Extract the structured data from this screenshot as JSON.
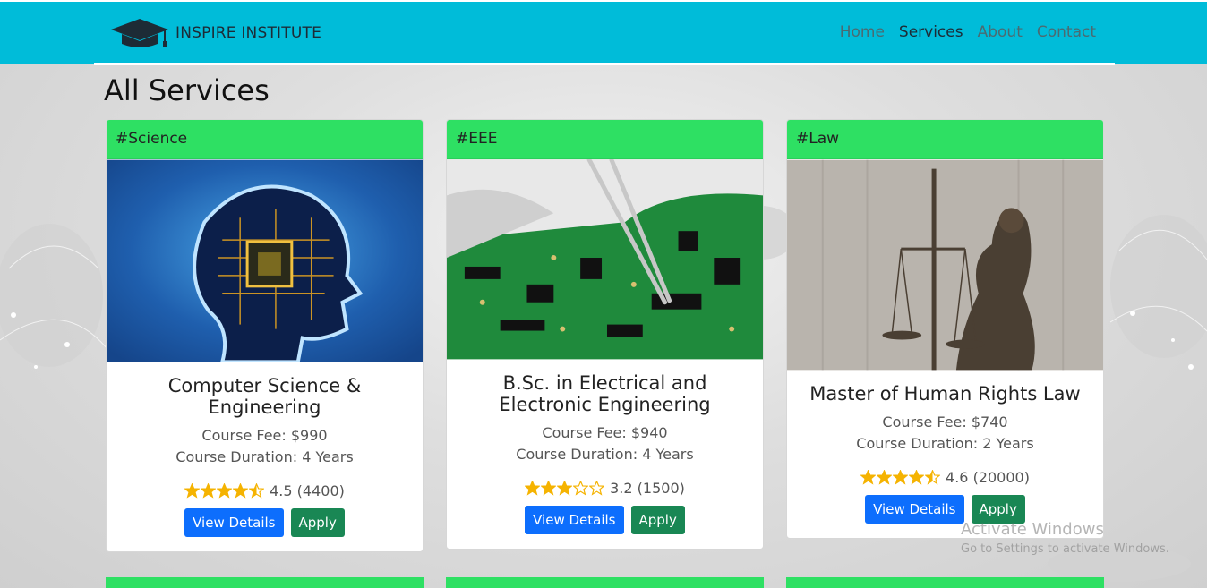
{
  "brand": {
    "name": "INSPIRE INSTITUTE",
    "icon": "graduation-cap-icon"
  },
  "nav": {
    "items": [
      "Home",
      "Services",
      "About",
      "Contact"
    ],
    "active": "Services"
  },
  "page": {
    "title": "All Services"
  },
  "cards": [
    {
      "tag": "#Science",
      "title": "Computer Science & Engineering",
      "fee": "Course Fee: $990",
      "duration": "Course Duration: 4 Years",
      "rating": 4.5,
      "rating_text": "4.5 (4400)",
      "view_label": "View Details",
      "apply_label": "Apply",
      "image": "ai-brain-chip-image"
    },
    {
      "tag": "#EEE",
      "title": "B.Sc. in Electrical and Electronic Engineering",
      "fee": "Course Fee: $940",
      "duration": "Course Duration: 4 Years",
      "rating": 3.2,
      "rating_text": "3.2 (1500)",
      "view_label": "View Details",
      "apply_label": "Apply",
      "image": "circuit-board-image"
    },
    {
      "tag": "#Law",
      "title": "Master of Human Rights Law",
      "fee": "Course Fee: $740",
      "duration": "Course Duration: 2 Years",
      "rating": 4.6,
      "rating_text": "4.6 (20000)",
      "view_label": "View Details",
      "apply_label": "Apply",
      "image": "lady-justice-statue-image"
    }
  ],
  "watermark": {
    "title": "Activate Windows",
    "subtitle": "Go to Settings to activate Windows."
  },
  "colors": {
    "navbar": "#00bcd9",
    "card_header": "#2ee063",
    "primary": "#0d6efd",
    "success": "#198754",
    "star": "#f5b301"
  }
}
